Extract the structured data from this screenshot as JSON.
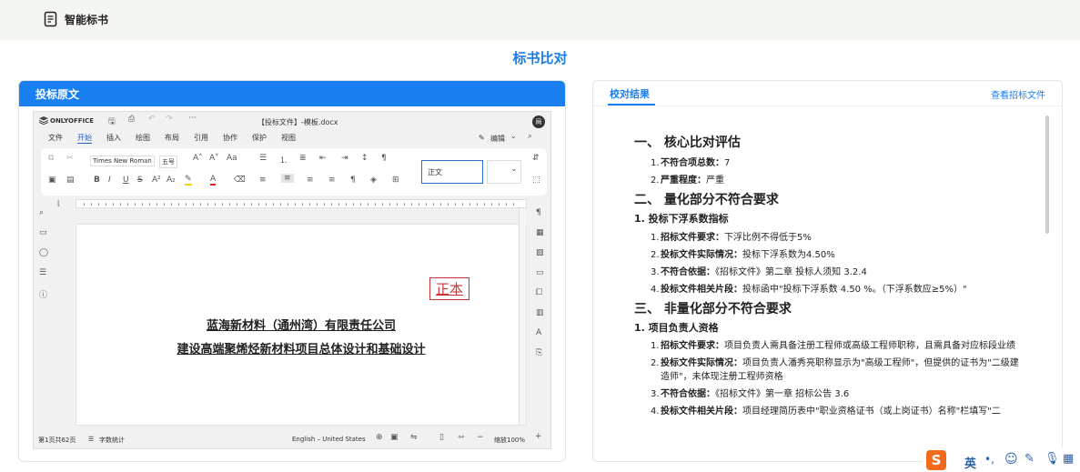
{
  "app": {
    "title": "智能标书"
  },
  "page": {
    "title": "标书比对"
  },
  "left_panel": {
    "title": "投标原文"
  },
  "editor": {
    "brand": "ONLYOFFICE",
    "filename": "【投标文件】-模板.docx",
    "user_initial": "局",
    "menu": [
      "文件",
      "开始",
      "插入",
      "绘图",
      "布局",
      "引用",
      "协作",
      "保护",
      "视图"
    ],
    "active_menu": "开始",
    "edit_mode": "编辑",
    "font_name": "Times New Roman",
    "font_size": "五号",
    "style_box": "正文",
    "document": {
      "stamp": "正本",
      "line1": "蓝海新材料（通州湾）有限责任公司",
      "line2": "建设高端聚烯烃新材料项目总体设计和基础设计"
    },
    "status": {
      "page": "第1页共62页",
      "word_count": "字数统计",
      "language": "English – United States",
      "zoom": "缩放100%"
    }
  },
  "right_panel": {
    "tab": "校对结果",
    "link": "查看招标文件",
    "sections": [
      {
        "type": "h1",
        "text": "一、 核心比对评估"
      },
      {
        "type": "item",
        "n": "1.",
        "label": "不符合项总数：",
        "text": "7"
      },
      {
        "type": "item",
        "n": "2.",
        "label": "严重程度：",
        "text": "严重"
      },
      {
        "type": "h1",
        "text": "二、 量化部分不符合要求"
      },
      {
        "type": "h2",
        "text": "1. 投标下浮系数指标"
      },
      {
        "type": "item",
        "n": "1.",
        "label": "招标文件要求：",
        "text": "下浮比例不得低于5%"
      },
      {
        "type": "item",
        "n": "2.",
        "label": "投标文件实际情况：",
        "text": "投标下浮系数为4.50%"
      },
      {
        "type": "item",
        "n": "3.",
        "label": "不符合依据：",
        "text": "《招标文件》第二章 投标人须知 3.2.4"
      },
      {
        "type": "item",
        "n": "4.",
        "label": "投标文件相关片段：",
        "text": "投标函中\"投标下浮系数 4.50 %。（下浮系数应≥5%）\""
      },
      {
        "type": "h1",
        "text": "三、 非量化部分不符合要求"
      },
      {
        "type": "h2",
        "text": "1. 项目负责人资格"
      },
      {
        "type": "item",
        "n": "1.",
        "label": "招标文件要求：",
        "text": "项目负责人需具备注册工程师或高级工程师职称，且需具备对应标段业绩"
      },
      {
        "type": "item",
        "n": "2.",
        "label": "投标文件实际情况：",
        "text": "项目负责人潘秀亮职称显示为\"高级工程师\"，但提供的证书为\"二级建造师\"，未体现注册工程师资格"
      },
      {
        "type": "item",
        "n": "3.",
        "label": "不符合依据：",
        "text": "《招标文件》第一章 招标公告 3.6"
      },
      {
        "type": "item",
        "n": "4.",
        "label": "投标文件相关片段：",
        "text": "项目经理简历表中\"职业资格证书（或上岗证书）名称\"栏填写\"二"
      }
    ]
  },
  "ime": {
    "lang": "英"
  },
  "colors": {
    "accent": "#1a7ff0",
    "stamp": "#cc3333"
  }
}
